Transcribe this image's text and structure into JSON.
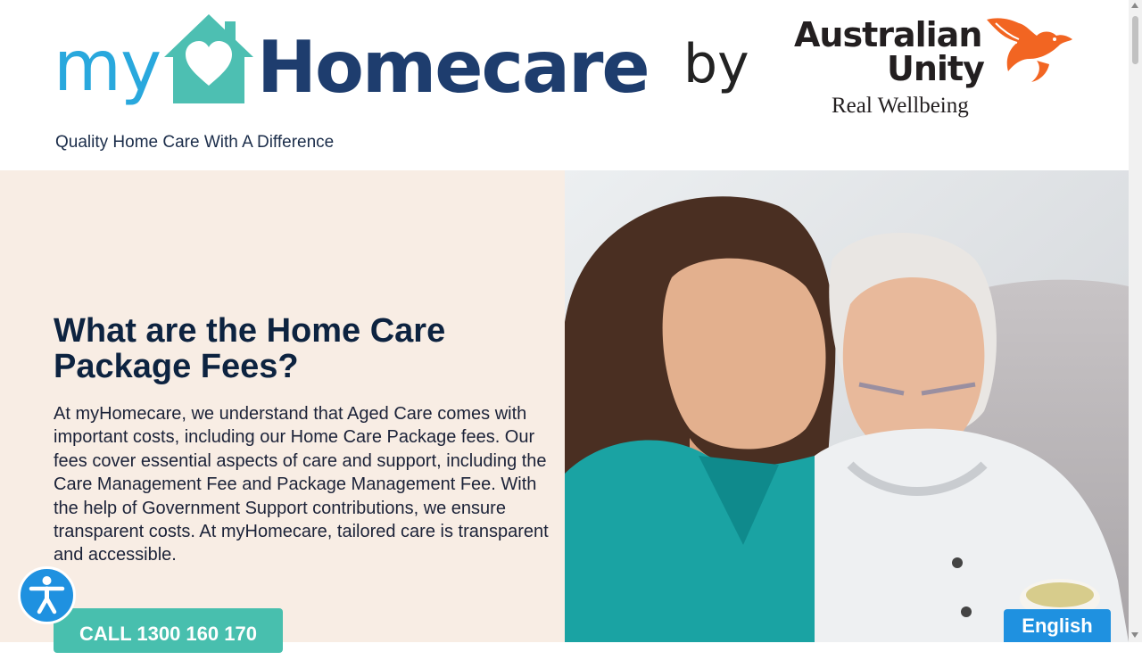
{
  "header": {
    "logo": {
      "my": "my",
      "home": "Homecare"
    },
    "tagline": "Quality Home Care With A Difference",
    "by": "by",
    "partner_logo": {
      "line1": "Australian",
      "line2": "Unity",
      "sub": "Real Wellbeing"
    }
  },
  "hero": {
    "title": "What are the Home Care Package Fees?",
    "body": "At myHomecare, we understand that Aged Care comes with important costs, including our Home Care Package fees. Our fees cover essential aspects of care and support, including the Care Management Fee and Package Management Fee. With the help of Government Support contributions, we ensure transparent costs. At myHomecare, tailored care is transparent and accessible.",
    "cta_label": "CALL 1300 160 170"
  },
  "widgets": {
    "accessibility_icon": "accessibility-icon",
    "language": "English"
  },
  "colors": {
    "brand_teal": "#48bfae",
    "brand_navy": "#1e3d6e",
    "brand_blue": "#29a8dd",
    "hero_bg": "#f8ede4",
    "widget_blue": "#1f91e0",
    "bird_orange": "#f26522"
  }
}
